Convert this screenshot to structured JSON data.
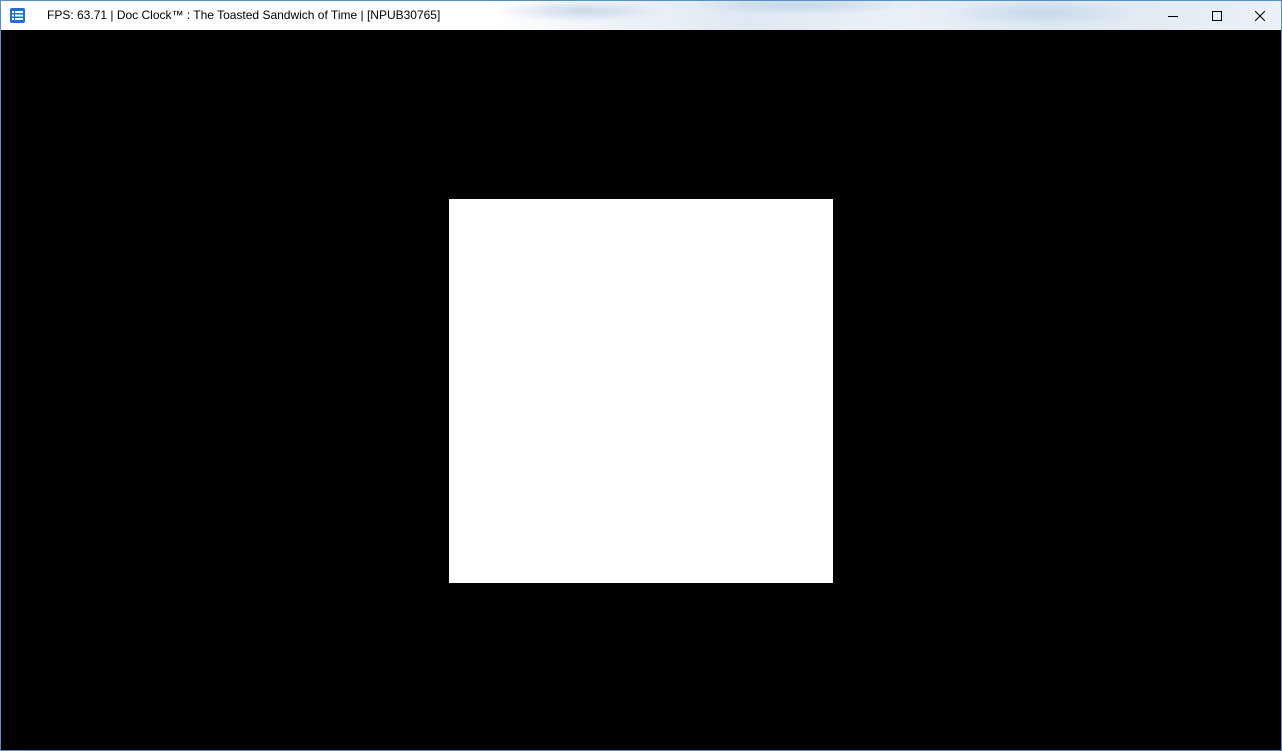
{
  "window": {
    "title": "FPS: 63.71 | Doc Clock™ : The Toasted Sandwich of Time | [NPUB30765]",
    "app_icon": "app-list-icon",
    "controls": {
      "minimize_icon": "minimize-icon",
      "maximize_icon": "maximize-icon",
      "close_icon": "close-icon"
    }
  },
  "game": {
    "background_color": "#000000",
    "square_color": "#ffffff"
  },
  "colors": {
    "window_border": "#5a8fc4",
    "icon_accent": "#1f6fd0"
  }
}
